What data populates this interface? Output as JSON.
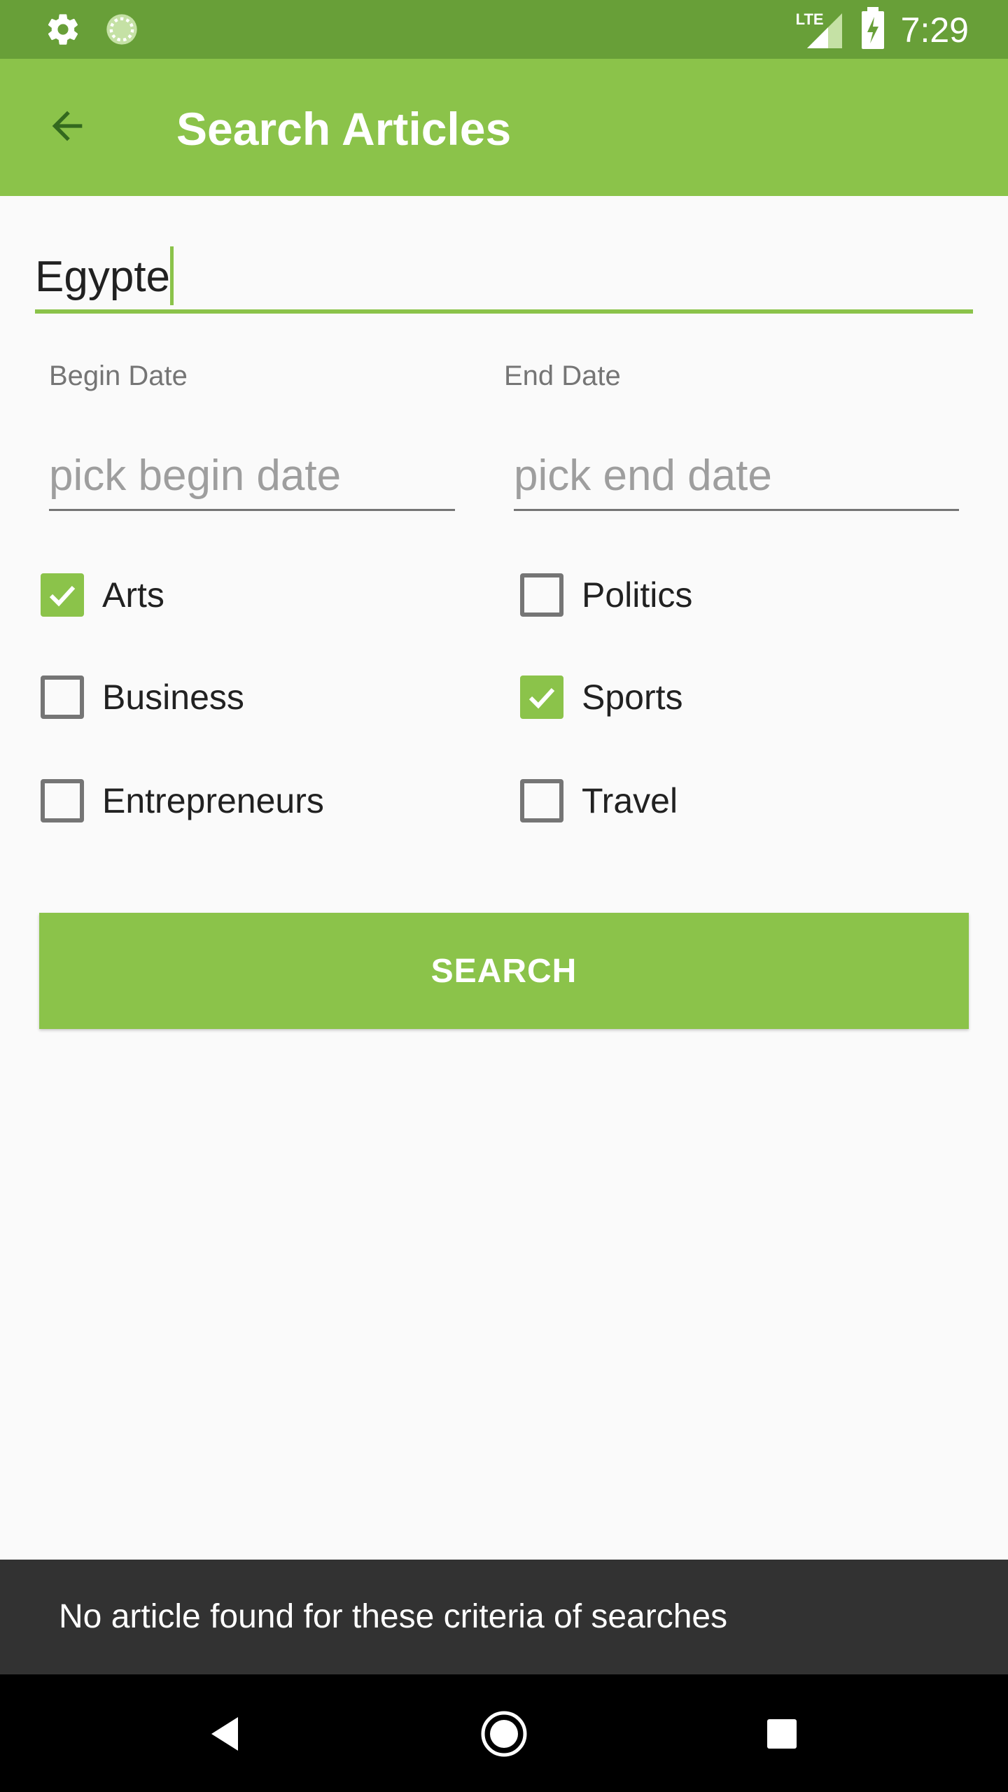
{
  "status_bar": {
    "time": "7:29",
    "network_label": "LTE",
    "icons": [
      "gear-icon",
      "sync-icon",
      "lte-signal-icon",
      "battery-charging-icon"
    ]
  },
  "app_bar": {
    "title": "Search Articles",
    "back_icon": "arrow-back-icon"
  },
  "search": {
    "value": "Egypte"
  },
  "dates": {
    "begin_label": "Begin Date",
    "end_label": "End Date",
    "begin_placeholder": "pick begin date",
    "end_placeholder": "pick end date"
  },
  "categories": [
    {
      "label": "Arts",
      "checked": true
    },
    {
      "label": "Politics",
      "checked": false
    },
    {
      "label": "Business",
      "checked": false
    },
    {
      "label": "Sports",
      "checked": true
    },
    {
      "label": "Entrepreneurs",
      "checked": false
    },
    {
      "label": "Travel",
      "checked": false
    }
  ],
  "search_button": {
    "label": "SEARCH"
  },
  "snackbar": {
    "message": "No article found for these criteria of searches"
  },
  "colors": {
    "primary": "#8bc34a",
    "primary_dark": "#689f38",
    "snackbar": "#323232"
  }
}
